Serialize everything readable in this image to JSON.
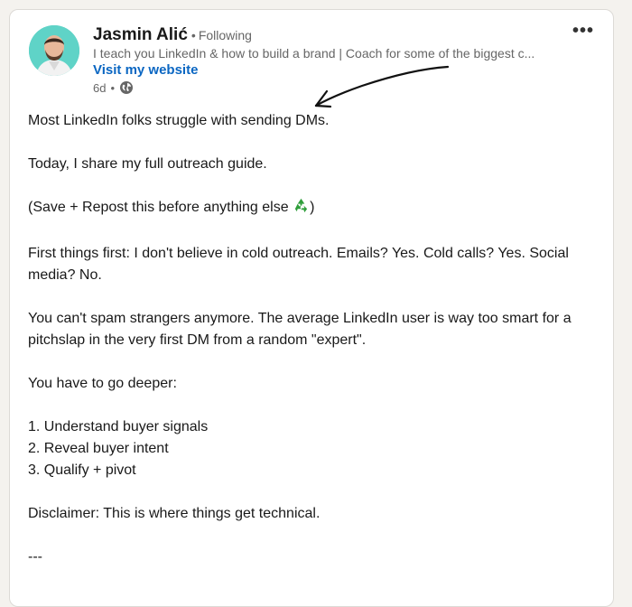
{
  "post": {
    "author": {
      "name": "Jasmin Alić",
      "follow_status": "Following",
      "headline": "I teach you LinkedIn & how to build a brand | Coach for some of the biggest c...",
      "website_link": "Visit my website",
      "time": "6d",
      "visibility_icon": "globe-icon"
    },
    "menu_icon": "more-options-icon",
    "body": {
      "p1": "Most LinkedIn folks struggle with sending DMs.",
      "p2": "Today, I share my full outreach guide.",
      "p3_before": "(Save + Repost this before anything else ",
      "p3_emoji": "recycle-emoji",
      "p3_after": ")",
      "p4": "First things first: I don't believe in cold outreach. Emails? Yes. Cold calls? Yes. Social media? No.",
      "p5": "You can't spam strangers anymore. The average LinkedIn user is way too smart for a pitchslap in the very first DM from a random \"expert\".",
      "p6": "You have to go deeper:",
      "list": [
        "1. Understand buyer signals",
        "2. Reveal buyer intent",
        "3. Qualify + pivot"
      ],
      "p7": "Disclaimer: This is where things get technical.",
      "divider": "---"
    }
  },
  "colors": {
    "link": "#0a66c2",
    "avatar_bg": "#5fd3c7",
    "secondary_text": "#666666"
  }
}
